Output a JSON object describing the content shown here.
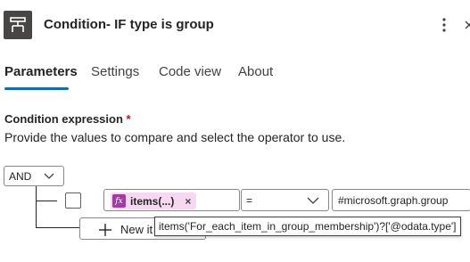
{
  "header": {
    "title": "Condition- IF type is group",
    "icon": "condition-icon",
    "more_icon": "more-vertical-icon",
    "close_icon": "close-icon"
  },
  "tabs": [
    {
      "label": "Parameters",
      "active": true
    },
    {
      "label": "Settings",
      "active": false
    },
    {
      "label": "Code view",
      "active": false
    },
    {
      "label": "About",
      "active": false
    }
  ],
  "condition": {
    "label": "Condition expression",
    "required_mark": "*",
    "description": "Provide the values to compare and select the operator to use.",
    "group_operator": "AND",
    "row": {
      "checked": false,
      "left_token": {
        "icon": "function-icon",
        "icon_text": "fx",
        "label": "items(...)",
        "remove": "×"
      },
      "operator": "=",
      "right_value": "#microsoft.graph.group"
    },
    "new_item_label": "New it",
    "tooltip": "items('For_each_item_in_group_membership')?['@odata.type']"
  },
  "colors": {
    "accent": "#0f6cbd",
    "header_icon_bg": "#484644",
    "token_bg": "#f6d8f0",
    "fx_icon_bg": "#9e3e9e",
    "required": "#c50f1f"
  }
}
